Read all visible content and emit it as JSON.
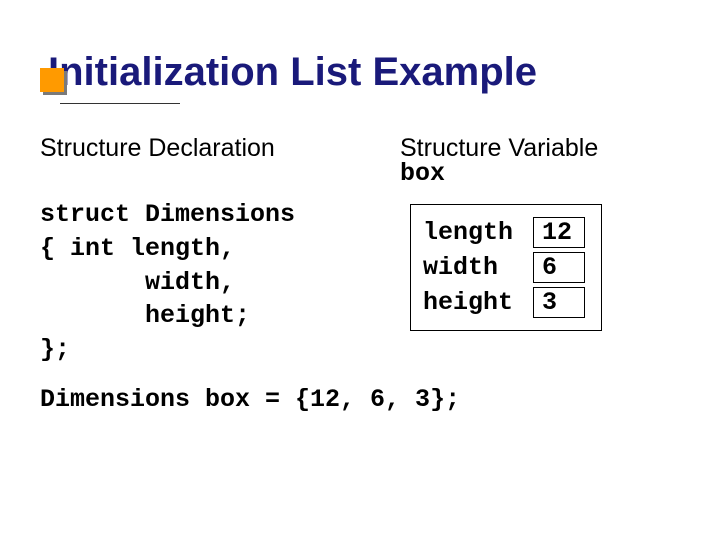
{
  "slide": {
    "title": "Initialization List Example",
    "declaration_header": "Structure Declaration",
    "variable_header": "Structure Variable",
    "box_label": "box",
    "code": "struct Dimensions\n{ int length,\n       width,\n       height;\n};",
    "members": [
      {
        "label": "length",
        "value": "12"
      },
      {
        "label": "width",
        "value": "6"
      },
      {
        "label": "height",
        "value": "3"
      }
    ],
    "init_line": "Dimensions box = {12, 6, 3};"
  }
}
